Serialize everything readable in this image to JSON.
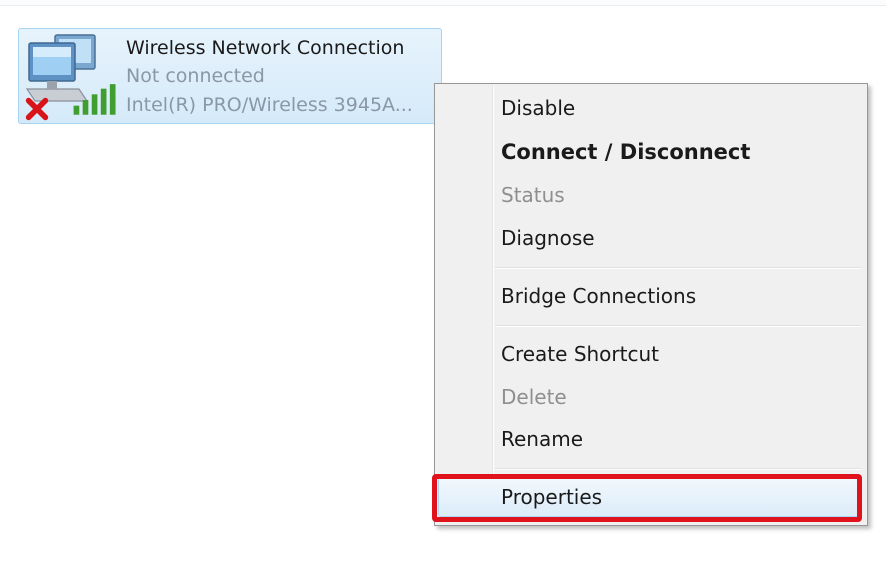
{
  "connection": {
    "name": "Wireless Network Connection",
    "status": "Not connected",
    "device": "Intel(R) PRO/Wireless 3945A...",
    "icon": "network-computers-icon",
    "overlay_icon": "red-x-icon",
    "signal_icon": "signal-bars-icon"
  },
  "context_menu": {
    "items": [
      {
        "label": "Disable",
        "state": "normal"
      },
      {
        "label": "Connect / Disconnect",
        "state": "default"
      },
      {
        "label": "Status",
        "state": "disabled"
      },
      {
        "label": "Diagnose",
        "state": "normal"
      },
      {
        "label": "Bridge Connections",
        "state": "normal"
      },
      {
        "label": "Create Shortcut",
        "state": "normal"
      },
      {
        "label": "Delete",
        "state": "disabled"
      },
      {
        "label": "Rename",
        "state": "normal"
      },
      {
        "label": "Properties",
        "state": "highlighted"
      }
    ]
  },
  "colors": {
    "highlight_border": "#e0121b",
    "selection_fill": "#d5eaf9",
    "disabled_text": "#8f8f8f"
  }
}
